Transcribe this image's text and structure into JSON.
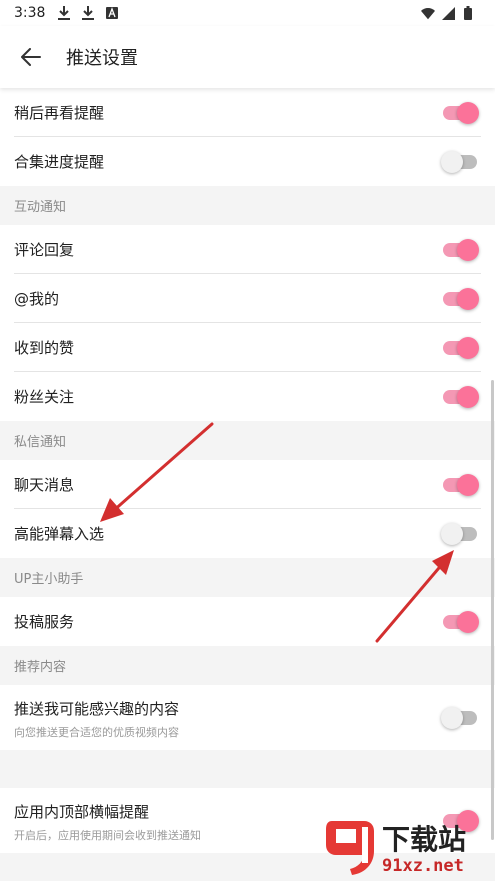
{
  "status_bar": {
    "time": "3:38",
    "left_icons": [
      "download-icon",
      "download-icon",
      "a-icon"
    ],
    "right_icons": [
      "wifi-icon",
      "signal-icon",
      "battery-icon"
    ]
  },
  "header": {
    "title": "推送设置",
    "back_icon": "arrow-left-icon"
  },
  "rows_top": [
    {
      "label": "稍后再看提醒",
      "toggle_on": true
    },
    {
      "label": "合集进度提醒",
      "toggle_on": false
    }
  ],
  "sections": [
    {
      "title": "互动通知",
      "items": [
        {
          "label": "评论回复",
          "toggle_on": true
        },
        {
          "label": "@我的",
          "toggle_on": true
        },
        {
          "label": "收到的赞",
          "toggle_on": true
        },
        {
          "label": "粉丝关注",
          "toggle_on": true
        }
      ]
    },
    {
      "title": "私信通知",
      "items": [
        {
          "label": "聊天消息",
          "toggle_on": true
        },
        {
          "label": "高能弹幕入选",
          "toggle_on": false
        }
      ]
    },
    {
      "title": "UP主小助手",
      "items": [
        {
          "label": "投稿服务",
          "toggle_on": true
        }
      ]
    },
    {
      "title": "推荐内容",
      "items": [
        {
          "label": "推送我可能感兴趣的内容",
          "sub": "向您推送更合适您的优质视频内容",
          "toggle_on": false
        }
      ]
    }
  ],
  "bottom_item": {
    "label": "应用内顶部横幅提醒",
    "sub": "开启后，应用使用期间会收到推送通知",
    "toggle_on": true
  },
  "watermark": {
    "title": "下载站",
    "url": "91xz.net",
    "logo_text": "91"
  },
  "colors": {
    "accent": "#fb7299",
    "track_on": "#f498b4",
    "track_off": "#bdbdbd",
    "arrow": "#d32f2f",
    "section_bg": "#f4f4f4"
  }
}
